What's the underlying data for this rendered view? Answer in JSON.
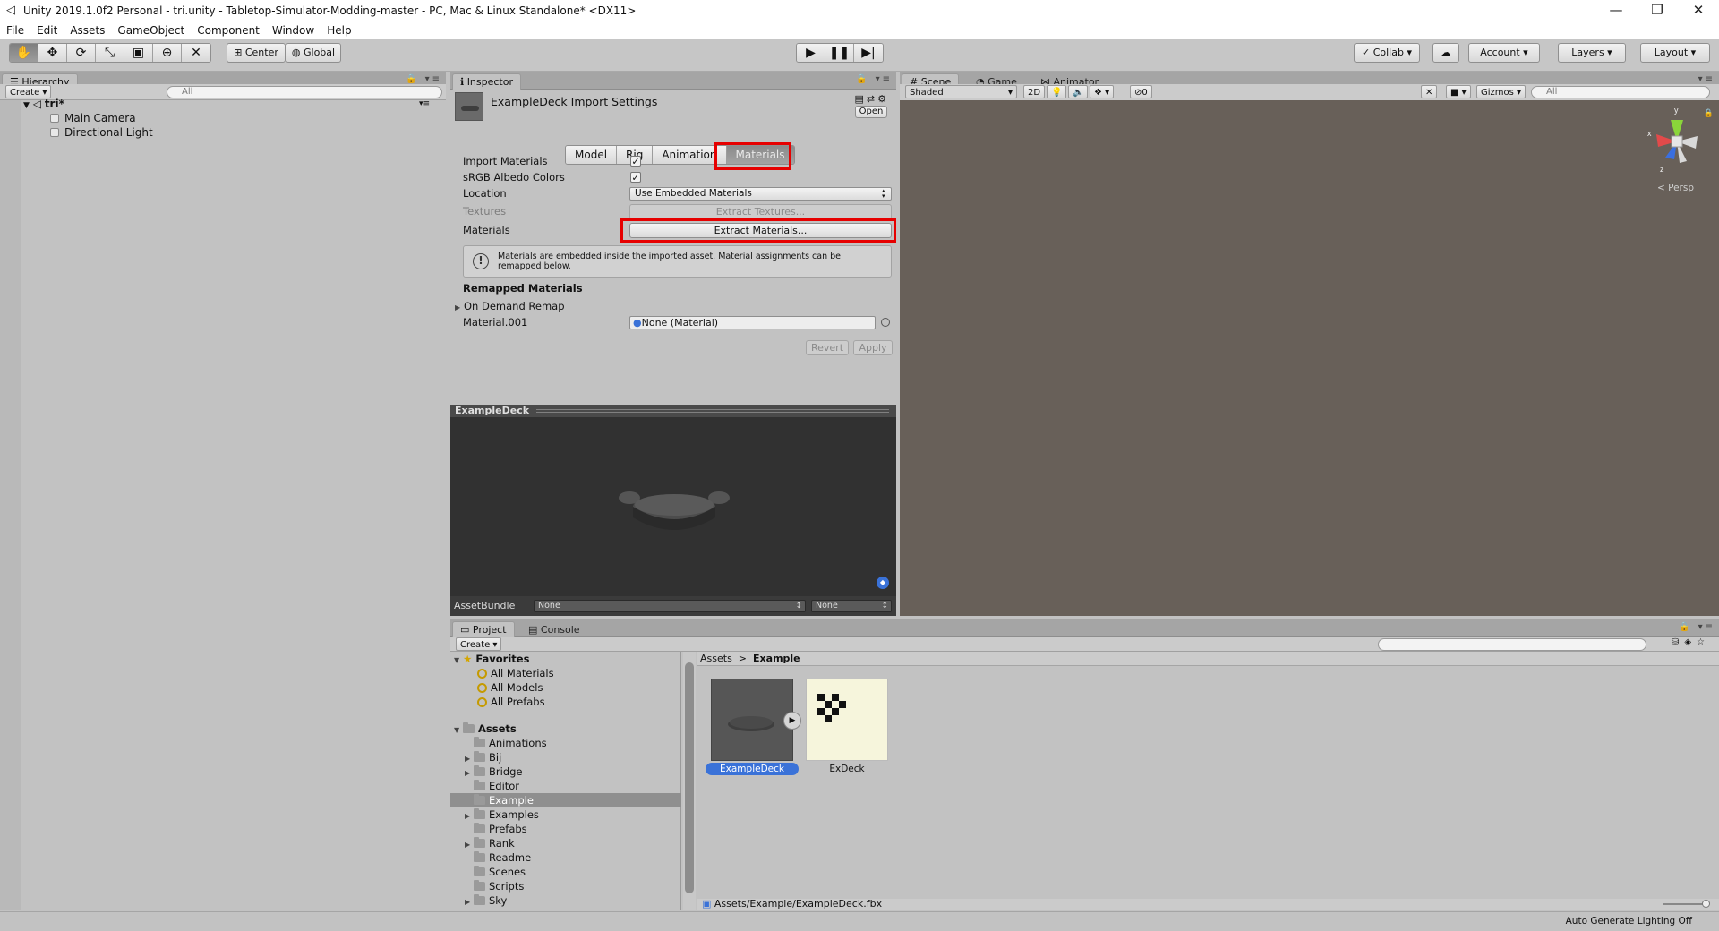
{
  "window": {
    "title": "Unity 2019.1.0f2 Personal - tri.unity - Tabletop-Simulator-Modding-master - PC, Mac & Linux Standalone* <DX11>",
    "controls": [
      "—",
      "❐",
      "✕"
    ]
  },
  "menu": [
    "File",
    "Edit",
    "Assets",
    "GameObject",
    "Component",
    "Window",
    "Help"
  ],
  "toolbar": {
    "center_label": "Center",
    "global_label": "Global",
    "collab_label": "Collab",
    "account_label": "Account",
    "layers_label": "Layers",
    "layout_label": "Layout"
  },
  "hierarchy": {
    "tab": "Hierarchy",
    "create_label": "Create",
    "search_placeholder": "All",
    "scene_name": "tri*",
    "items": [
      "Main Camera",
      "Directional Light"
    ]
  },
  "inspector": {
    "tab": "Inspector",
    "header_title": "ExampleDeck Import Settings",
    "open_label": "Open",
    "tabs": [
      "Model",
      "Rig",
      "Animation",
      "Materials"
    ],
    "selected_tab": "Materials",
    "fields": {
      "import_materials": "Import Materials",
      "srgb": "sRGB Albedo Colors",
      "location": "Location",
      "location_value": "Use Embedded Materials",
      "textures": "Textures",
      "extract_textures": "Extract Textures...",
      "materials": "Materials",
      "extract_materials": "Extract Materials..."
    },
    "info_text": "Materials are embedded inside the imported asset. Material assignments can be remapped below.",
    "remapped_header": "Remapped Materials",
    "on_demand_remap": "On Demand Remap",
    "material_name": "Material.001",
    "material_value": "None (Material)",
    "revert_label": "Revert",
    "apply_label": "Apply",
    "import_materials_checked": true,
    "srgb_checked": true
  },
  "preview": {
    "title": "ExampleDeck",
    "assetbundle_label": "AssetBundle",
    "assetbundle_value": "None",
    "variant_value": "None"
  },
  "scene": {
    "tabs": [
      "Scene",
      "Game",
      "Animator"
    ],
    "shaded": "Shaded",
    "mode_2d": "2D",
    "gizmos": "Gizmos",
    "search_placeholder": "All",
    "fx_count": "0",
    "persp": "Persp",
    "axis_x": "x",
    "axis_y": "y",
    "axis_z": "z",
    "background_color": "#686059"
  },
  "project": {
    "tabs": [
      "Project",
      "Console"
    ],
    "create_label": "Create",
    "favorites_label": "Favorites",
    "favorites": [
      "All Materials",
      "All Models",
      "All Prefabs"
    ],
    "assets_label": "Assets",
    "folders": [
      "Animations",
      "Bij",
      "Bridge",
      "Editor",
      "Example",
      "Examples",
      "Prefabs",
      "Rank",
      "Readme",
      "Scenes",
      "Scripts",
      "Sky"
    ],
    "selected_folder": "Example",
    "breadcrumb_root": "Assets",
    "breadcrumb_current": "Example",
    "assets": [
      "ExampleDeck",
      "ExDeck"
    ],
    "selected_path": "Assets/Example/ExampleDeck.fbx"
  },
  "status": {
    "text": "Auto Generate Lighting Off"
  },
  "colors": {
    "highlight_red": "#e60000",
    "selection_blue": "#3a72d8"
  }
}
